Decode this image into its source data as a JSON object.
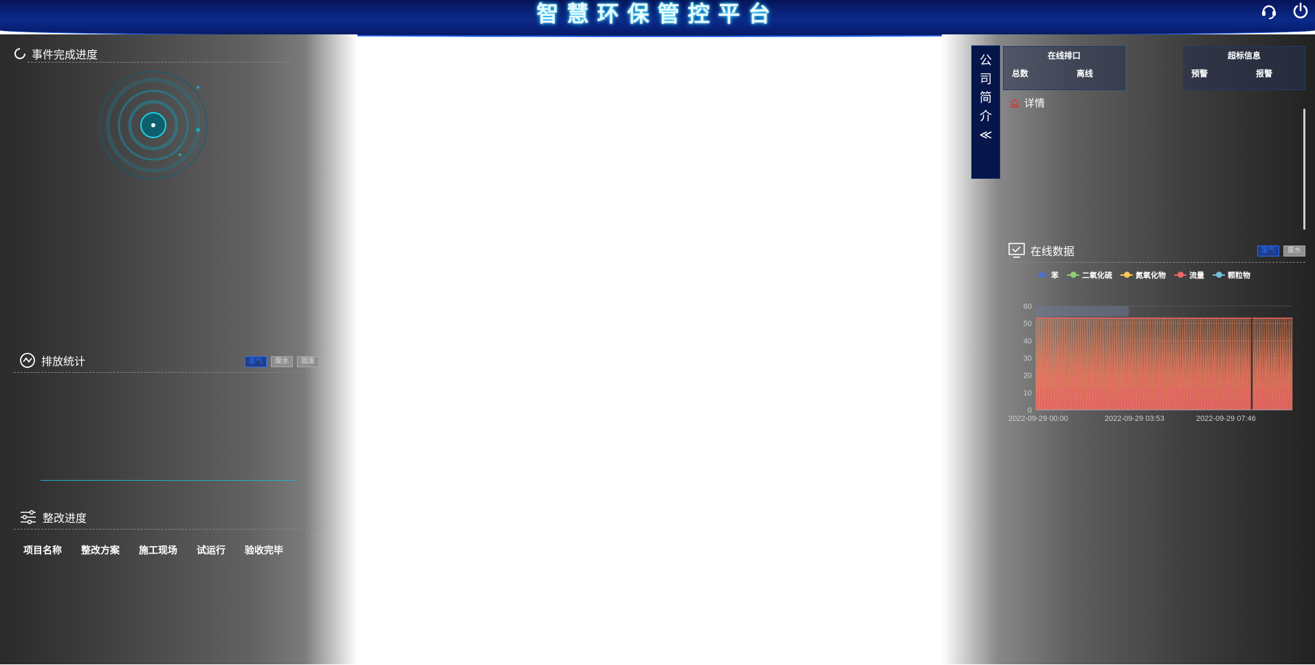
{
  "header": {
    "title": "智慧环保管控平台"
  },
  "left": {
    "events_title": "事件完成进度",
    "emission_title": "排放统计",
    "emission_tabs": [
      "废气",
      "废水",
      "固废"
    ],
    "rectify_title": "整改进度",
    "rectify_columns": [
      "项目名称",
      "整改方案",
      "施工现场",
      "试运行",
      "验收完毕"
    ]
  },
  "right": {
    "intro_tab": [
      "公",
      "司",
      "简",
      "介",
      "≪"
    ],
    "online_ports": {
      "title": "在线排口",
      "total": "总数",
      "offline": "离线"
    },
    "overlimit": {
      "title": "超标信息",
      "warning": "预警",
      "alarm": "报警"
    },
    "details_label": "详情",
    "online_data_title": "在线数据",
    "online_tabs": [
      "废气",
      "废水"
    ]
  },
  "colors": {
    "accent": "#2a6cff",
    "header_bg": "#0b2a8a",
    "flow_series": "#ee6666"
  },
  "chart_data": {
    "type": "line",
    "legend": [
      "苯",
      "二氧化硫",
      "氮氧化物",
      "流量",
      "颗粒物"
    ],
    "legend_colors": [
      "#5470c6",
      "#91cc75",
      "#fac858",
      "#ee6666",
      "#73c0de"
    ],
    "y_ticks": [
      "60",
      "50",
      "40",
      "30",
      "20",
      "10",
      "0"
    ],
    "ylim": [
      0,
      60
    ],
    "x_ticks": [
      "2022-09-29 00:00",
      "2022-09-29 03:53",
      "2022-09-29 07:46"
    ],
    "series": [
      {
        "name": "流量",
        "approx_range": [
          0,
          53
        ],
        "note_value_high": 53
      }
    ]
  }
}
